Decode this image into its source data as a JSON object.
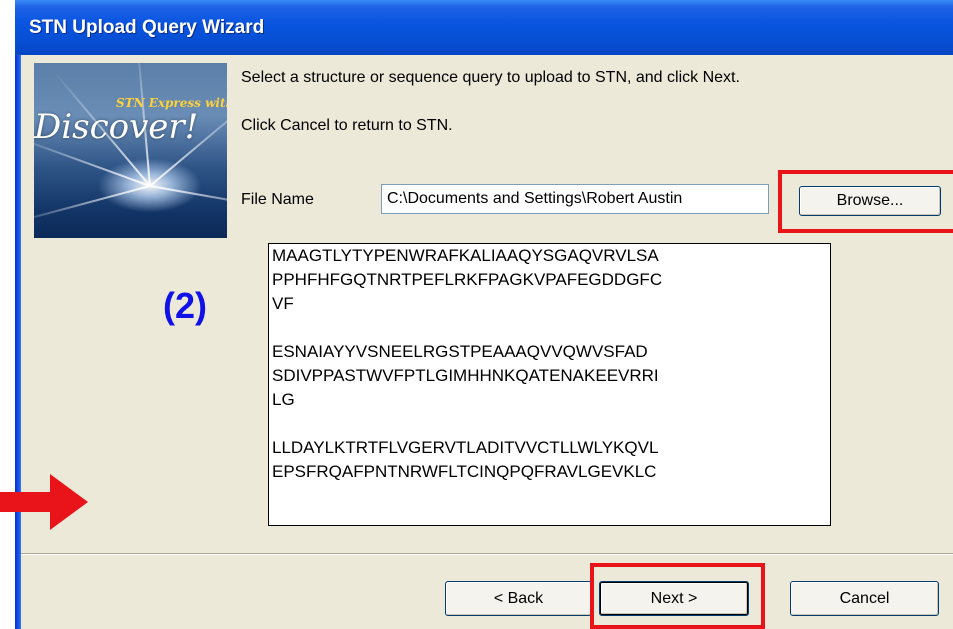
{
  "dialog": {
    "title": "STN Upload Query Wizard",
    "logo": {
      "small_text": "STN Express with",
      "big_text": "Discover!"
    },
    "instruction_1": "Select a structure or sequence query to upload to STN, and click Next.",
    "instruction_2": "Click Cancel to return to STN.",
    "file_name_label": "File Name",
    "file_name_value": "C:\\Documents and Settings\\Robert Austin",
    "browse_label": "Browse...",
    "sequence_lines": [
      "MAAGTLYTYPENWRAFKALIAAQYSGAQVRVLSA",
      "PPHFHFGQTNRTPEFLRKFPAGKVPAFEGDDGFC",
      "VF",
      "",
      "ESNAIAYYVSNEELRGSTPEAAAQVVQWVSFAD",
      "SDIVPPASTWVFPTLGIMHHNKQATENAKEEVRRI",
      "LG",
      "",
      "LLDAYLKTRTFLVGERVTLADITVVCTLLWLYKQVL",
      "EPSFRQAFPNTNRWFLTCINQPQFRAVLGEVKLC"
    ],
    "buttons": {
      "back": "< Back",
      "next": "Next >",
      "cancel": "Cancel"
    }
  },
  "annotations": {
    "step_label": "(2)",
    "highlight_color": "#E8141A",
    "arrow_color": "#E8141A",
    "step_label_color": "#1010E8"
  },
  "colors": {
    "titlebar": "#0650D6",
    "dialog_bg": "#ECE9D8"
  }
}
